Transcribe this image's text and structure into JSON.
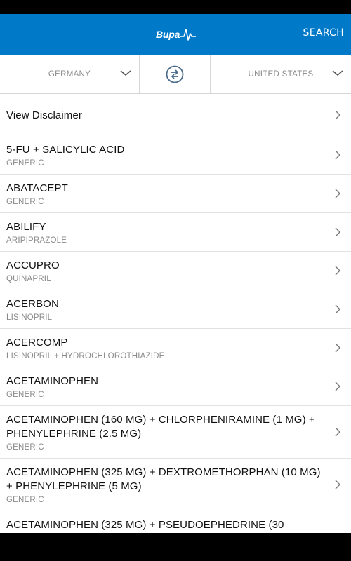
{
  "header": {
    "logo_text": "Bupa",
    "search_label": "SEARCH"
  },
  "countries": {
    "from": "GERMANY",
    "to": "UNITED STATES"
  },
  "disclaimer": {
    "label": "View Disclaimer"
  },
  "drugs": [
    {
      "name": "5-FU + SALICYLIC ACID",
      "sub": "GENERIC"
    },
    {
      "name": "ABATACEPT",
      "sub": "GENERIC"
    },
    {
      "name": "ABILIFY",
      "sub": "ARIPIPRAZOLE"
    },
    {
      "name": "ACCUPRO",
      "sub": "QUINAPRIL"
    },
    {
      "name": "ACERBON",
      "sub": "LISINOPRIL"
    },
    {
      "name": "ACERCOMP",
      "sub": "LISINOPRIL + HYDROCHLOROTHIAZIDE"
    },
    {
      "name": "ACETAMINOPHEN",
      "sub": "GENERIC"
    },
    {
      "name": "ACETAMINOPHEN (160 MG) + CHLORPHENIRAMINE (1 MG) + PHENYLEPHRINE (2.5 MG)",
      "sub": "GENERIC"
    },
    {
      "name": "ACETAMINOPHEN (325 MG) + DEXTROMETHORPHAN (10 MG) + PHENYLEPHRINE (5 MG)",
      "sub": "GENERIC"
    },
    {
      "name": "ACETAMINOPHEN (325 MG) + PSEUDOEPHEDRINE (30",
      "sub": ""
    }
  ],
  "colors": {
    "header_bg": "#0079c8",
    "swap_icon": "#4a6a8a"
  }
}
